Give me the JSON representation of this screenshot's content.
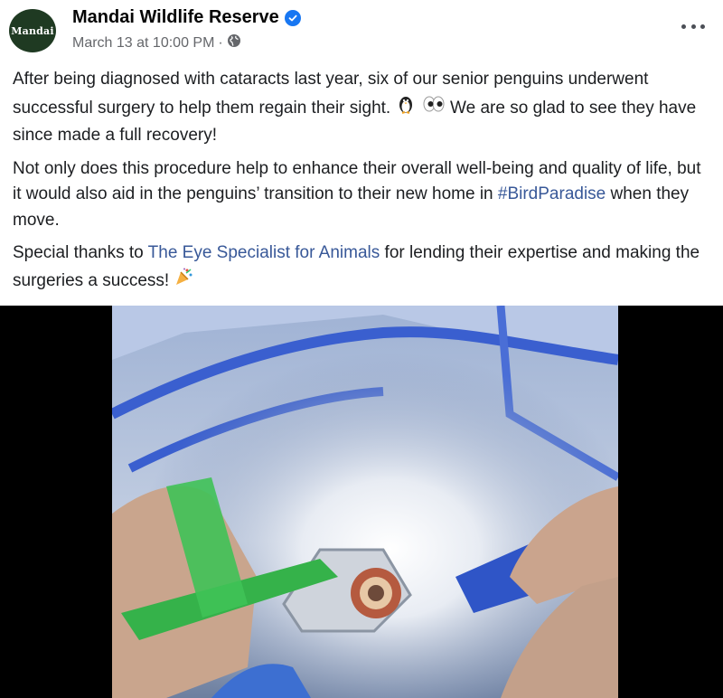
{
  "post": {
    "page_name": "Mandai Wildlife Reserve",
    "timestamp": "March 13 at 10:00 PM",
    "meta_separator": "·",
    "avatar_text": "Mandai",
    "icons": {
      "verified": "verified-badge-icon",
      "audience": "globe-icon",
      "more": "more-options-icon"
    },
    "paragraphs": {
      "p1_text": "After being diagnosed with cataracts last year, six of our senior penguins underwent successful surgery to help them regain their sight. ",
      "p1_end": " We are so glad to see they have since made a full recovery!",
      "p2_text": "Not only does this procedure help to enhance their overall well-being and quality of life, but it would also aid in the penguins’ transition to their new home in ",
      "p2_hashtag": "#BirdParadise",
      "p2_end": " when they move.",
      "p3_text": "Special thanks to ",
      "p3_link": "The Eye Specialist for Animals",
      "p3_end": " for lending their expertise and making the surgeries a success! "
    },
    "colors": {
      "link": "#385898",
      "avatar_bg": "#1f3a22",
      "verified": "#1877f2"
    }
  }
}
